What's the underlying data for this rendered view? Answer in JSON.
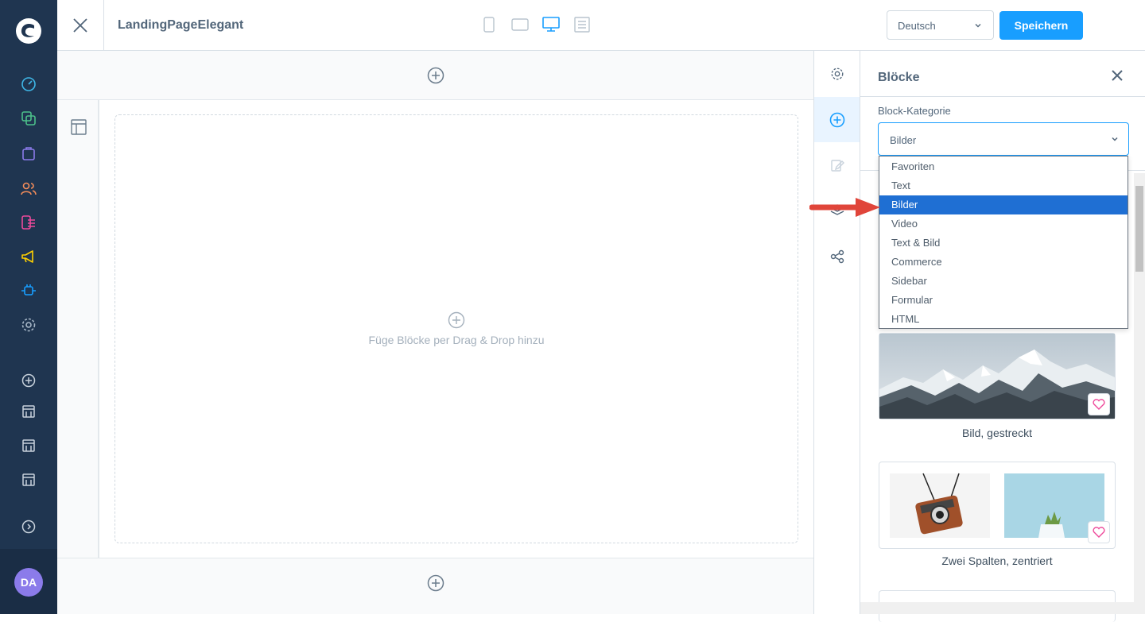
{
  "app": {
    "page_title": "LandingPageElegant",
    "language_select": "Deutsch",
    "save_label": "Speichern",
    "avatar_initials": "DA"
  },
  "canvas": {
    "dropzone_hint": "Füge Blöcke per Drag & Drop hinzu"
  },
  "panel": {
    "title": "Blöcke",
    "category_label": "Block-Kategorie",
    "category_value": "Bilder",
    "options": [
      "Favoriten",
      "Text",
      "Bilder",
      "Video",
      "Text & Bild",
      "Commerce",
      "Sidebar",
      "Formular",
      "HTML"
    ],
    "selected_option": "Bilder",
    "blocks": [
      {
        "label": "Bild, gestreckt"
      },
      {
        "label": "Zwei Spalten, zentriert"
      }
    ]
  },
  "icons": {
    "nav": [
      "dashboard-icon",
      "catalogue-icon",
      "orders-icon",
      "customers-icon",
      "content-icon",
      "marketing-icon",
      "extensions-icon",
      "settings-icon",
      "add-icon",
      "sales-channel-icon",
      "sales-channel-icon",
      "sales-channel-icon",
      "expand-icon"
    ],
    "viewport": [
      "mobile-icon",
      "tablet-icon",
      "desktop-icon",
      "list-icon"
    ],
    "strip": [
      "settings-icon",
      "add-block-icon",
      "edit-icon",
      "layers-icon",
      "share-icon"
    ]
  },
  "colors": {
    "nav_bg": "#1f3550",
    "accent": "#189eff",
    "selected_option": "#1f6fd3",
    "arrow": "#e0453a"
  }
}
